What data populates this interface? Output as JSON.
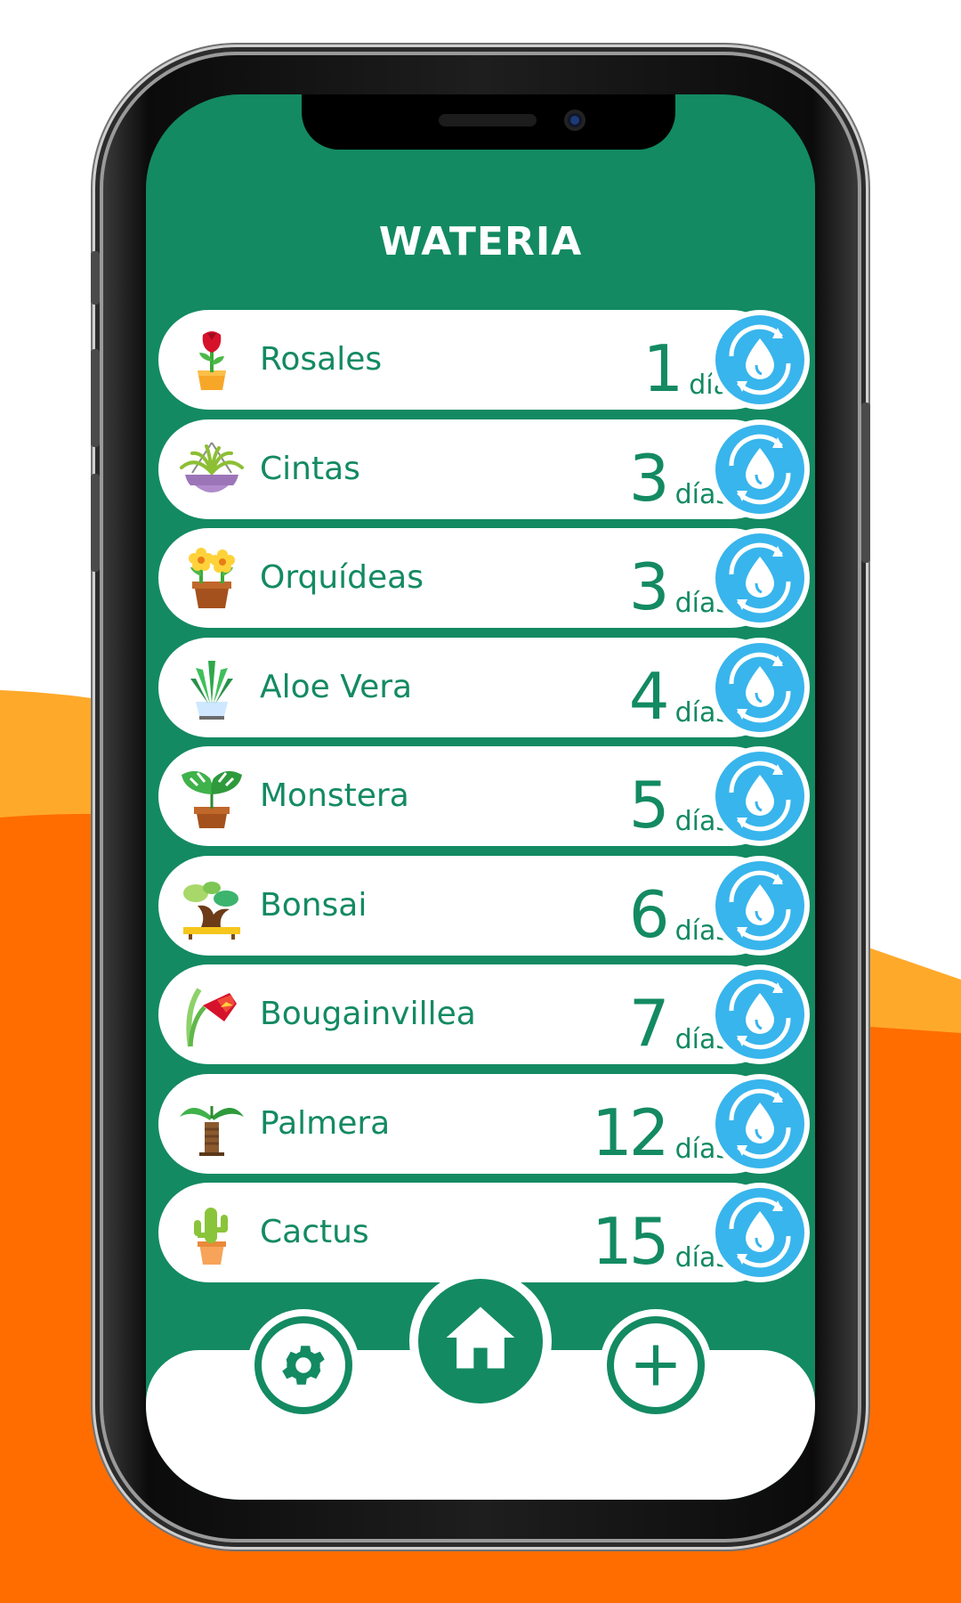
{
  "app": {
    "title": "WATERIA"
  },
  "plants": [
    {
      "name": "Rosales",
      "days": "1",
      "unit": "día",
      "icon": "rose-icon"
    },
    {
      "name": "Cintas",
      "days": "3",
      "unit": "días",
      "icon": "spider-plant-icon"
    },
    {
      "name": "Orquídeas",
      "days": "3",
      "unit": "días",
      "icon": "orchid-icon"
    },
    {
      "name": "Aloe Vera",
      "days": "4",
      "unit": "días",
      "icon": "aloe-icon"
    },
    {
      "name": "Monstera",
      "days": "5",
      "unit": "días",
      "icon": "monstera-icon"
    },
    {
      "name": "Bonsai",
      "days": "6",
      "unit": "días",
      "icon": "bonsai-icon"
    },
    {
      "name": "Bougainvillea",
      "days": "7",
      "unit": "días",
      "icon": "bougainvillea-icon"
    },
    {
      "name": "Palmera",
      "days": "12",
      "unit": "días",
      "icon": "palm-icon"
    },
    {
      "name": "Cactus",
      "days": "15",
      "unit": "días",
      "icon": "cactus-icon"
    }
  ],
  "nav": {
    "settings_icon": "gear-icon",
    "home_icon": "home-icon",
    "add_icon": "plus-icon"
  },
  "colors": {
    "primary": "#138a62",
    "water": "#38b5ec",
    "orange": "#ff6d00",
    "orange_light": "#ffa92b"
  }
}
